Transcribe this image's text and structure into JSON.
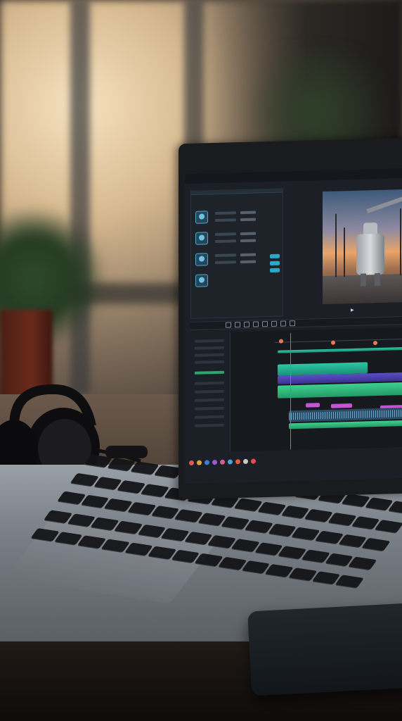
{
  "scene": {
    "description_colors": {
      "screen_bg": "#1c2026",
      "accent_teal": "#2cc7a4",
      "accent_purple": "#5b4fc6",
      "accent_pink": "#c454d6",
      "playhead": "#e35a4a"
    }
  },
  "screen": {
    "menu": [
      "",
      "",
      "",
      "",
      "",
      "",
      "",
      "",
      ""
    ],
    "app_title": "",
    "panel_head": "",
    "inspector_head": "",
    "timecode": "",
    "timeline_labels": [
      "",
      "",
      ""
    ],
    "status": ""
  },
  "icons": {
    "toolbar": [
      "cut-icon",
      "select-icon",
      "blade-icon",
      "zoom-icon",
      "snap-icon",
      "link-icon",
      "marker-icon",
      "audio-icon"
    ]
  }
}
